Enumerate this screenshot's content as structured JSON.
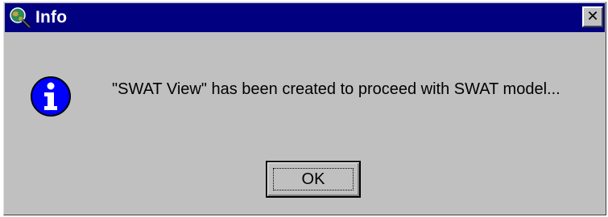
{
  "window": {
    "title": "Info",
    "close_glyph": "✕",
    "titlebar_color": "#000080",
    "face_color": "#c0c0c0"
  },
  "dialog": {
    "icon": "info-icon",
    "message": "\"SWAT View\" has been created to proceed with SWAT model...",
    "ok_label": "OK"
  }
}
